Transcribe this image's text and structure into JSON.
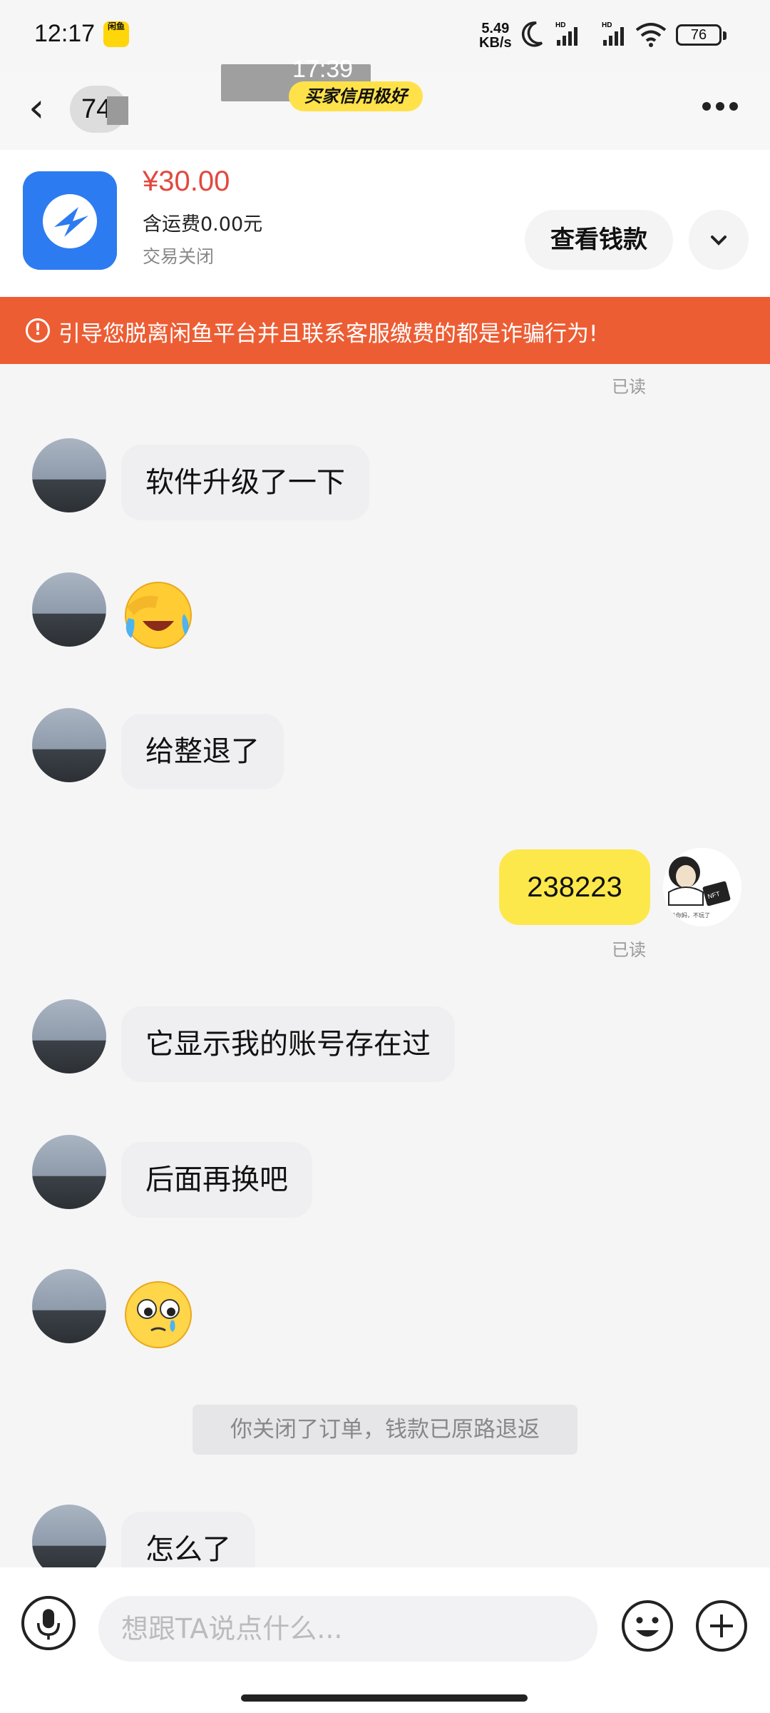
{
  "status_bar": {
    "time": "12:17",
    "app_icon_label": "闲鱼",
    "network_speed_value": "5.49",
    "network_speed_unit": "KB/s",
    "signal_1_label": "HD",
    "signal_2_label": "HD",
    "battery": "76"
  },
  "header": {
    "contact_name_partial": "74",
    "overlay_time": "17:39",
    "credit_badge": "买家信用极好"
  },
  "product": {
    "price": "¥30.00",
    "shipping": "含运费0.00元",
    "status": "交易关闭",
    "view_button": "查看钱款"
  },
  "warning_banner": {
    "text": "引导您脱离闲鱼平台并且联系客服缴费的都是诈骗行为!"
  },
  "messages": [
    {
      "from": "other",
      "type": "text",
      "text": "软件升级了一下"
    },
    {
      "from": "other",
      "type": "emoji",
      "emoji": "facepalm-laughing-crying"
    },
    {
      "from": "other",
      "type": "text",
      "text": "给整退了"
    },
    {
      "from": "me",
      "type": "text",
      "text": "238223"
    },
    {
      "from": "other",
      "type": "text",
      "text": "它显示我的账号存在过"
    },
    {
      "from": "other",
      "type": "text",
      "text": "后面再换吧"
    },
    {
      "from": "other",
      "type": "emoji",
      "emoji": "pleading-teary-face"
    },
    {
      "from": "system",
      "type": "notice",
      "text": "你关闭了订单，钱款已原路退返"
    },
    {
      "from": "other",
      "type": "text",
      "text": "怎么了"
    }
  ],
  "read_receipt": "已读",
  "my_avatar_caption": "与你妈，不玩了",
  "my_avatar_tag": "NFT",
  "input": {
    "placeholder": "想跟TA说点什么..."
  },
  "colors": {
    "accent_yellow": "#fde84b",
    "price_red": "#e2483e",
    "warning_orange": "#ed5d34"
  }
}
